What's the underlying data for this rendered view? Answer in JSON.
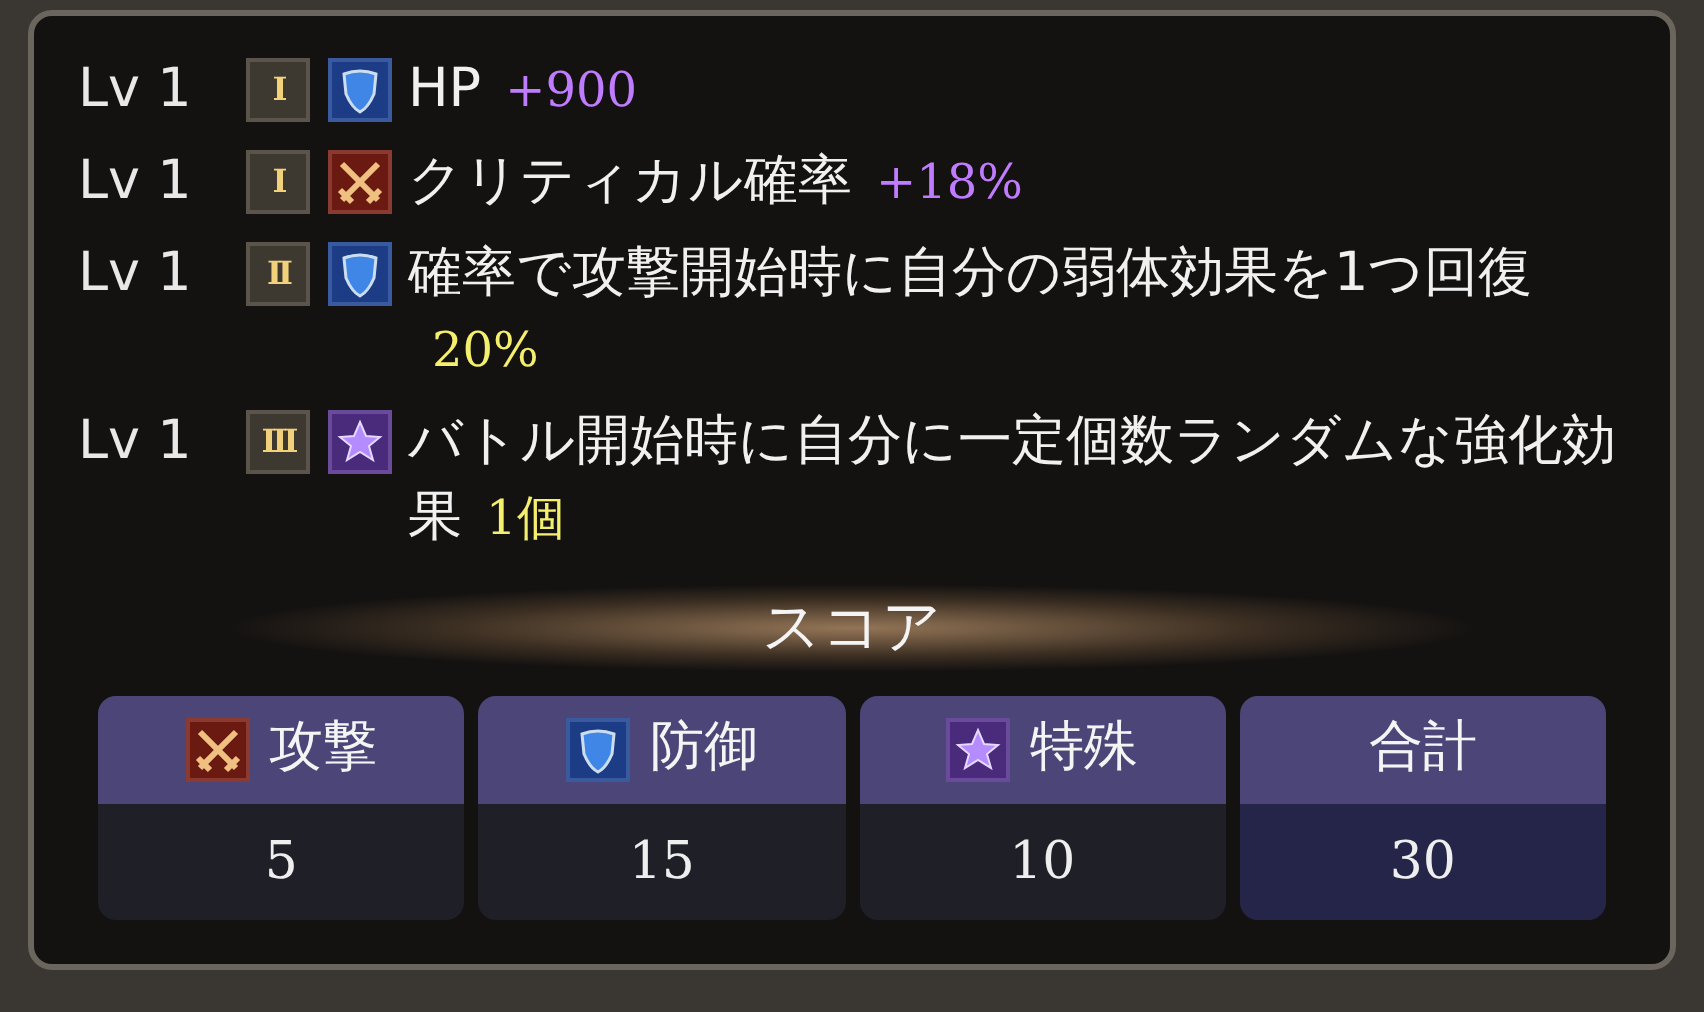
{
  "skills": [
    {
      "level": "Lv 1",
      "tier": "I",
      "kind": "shield",
      "text": "HP",
      "value": "+900",
      "color": "#c07cff"
    },
    {
      "level": "Lv 1",
      "tier": "I",
      "kind": "swords",
      "text": "クリティカル確率",
      "value": "+18%",
      "color": "#c07cff"
    },
    {
      "level": "Lv 1",
      "tier": "II",
      "kind": "shield",
      "text": "確率で攻撃開始時に自分の弱体効果を1つ回復",
      "value": "20%",
      "color": "#f4ef6e"
    },
    {
      "level": "Lv 1",
      "tier": "III",
      "kind": "star",
      "text": "バトル開始時に自分に一定個数ランダムな強化効果",
      "value": "1個",
      "color": "#f4ef6e"
    }
  ],
  "score": {
    "title": "スコア",
    "cells": [
      {
        "kind": "swords",
        "label": "攻撃",
        "value": "5"
      },
      {
        "kind": "shield",
        "label": "防御",
        "value": "15"
      },
      {
        "kind": "star",
        "label": "特殊",
        "value": "10"
      },
      {
        "kind": "total",
        "label": "合計",
        "value": "30"
      }
    ]
  }
}
